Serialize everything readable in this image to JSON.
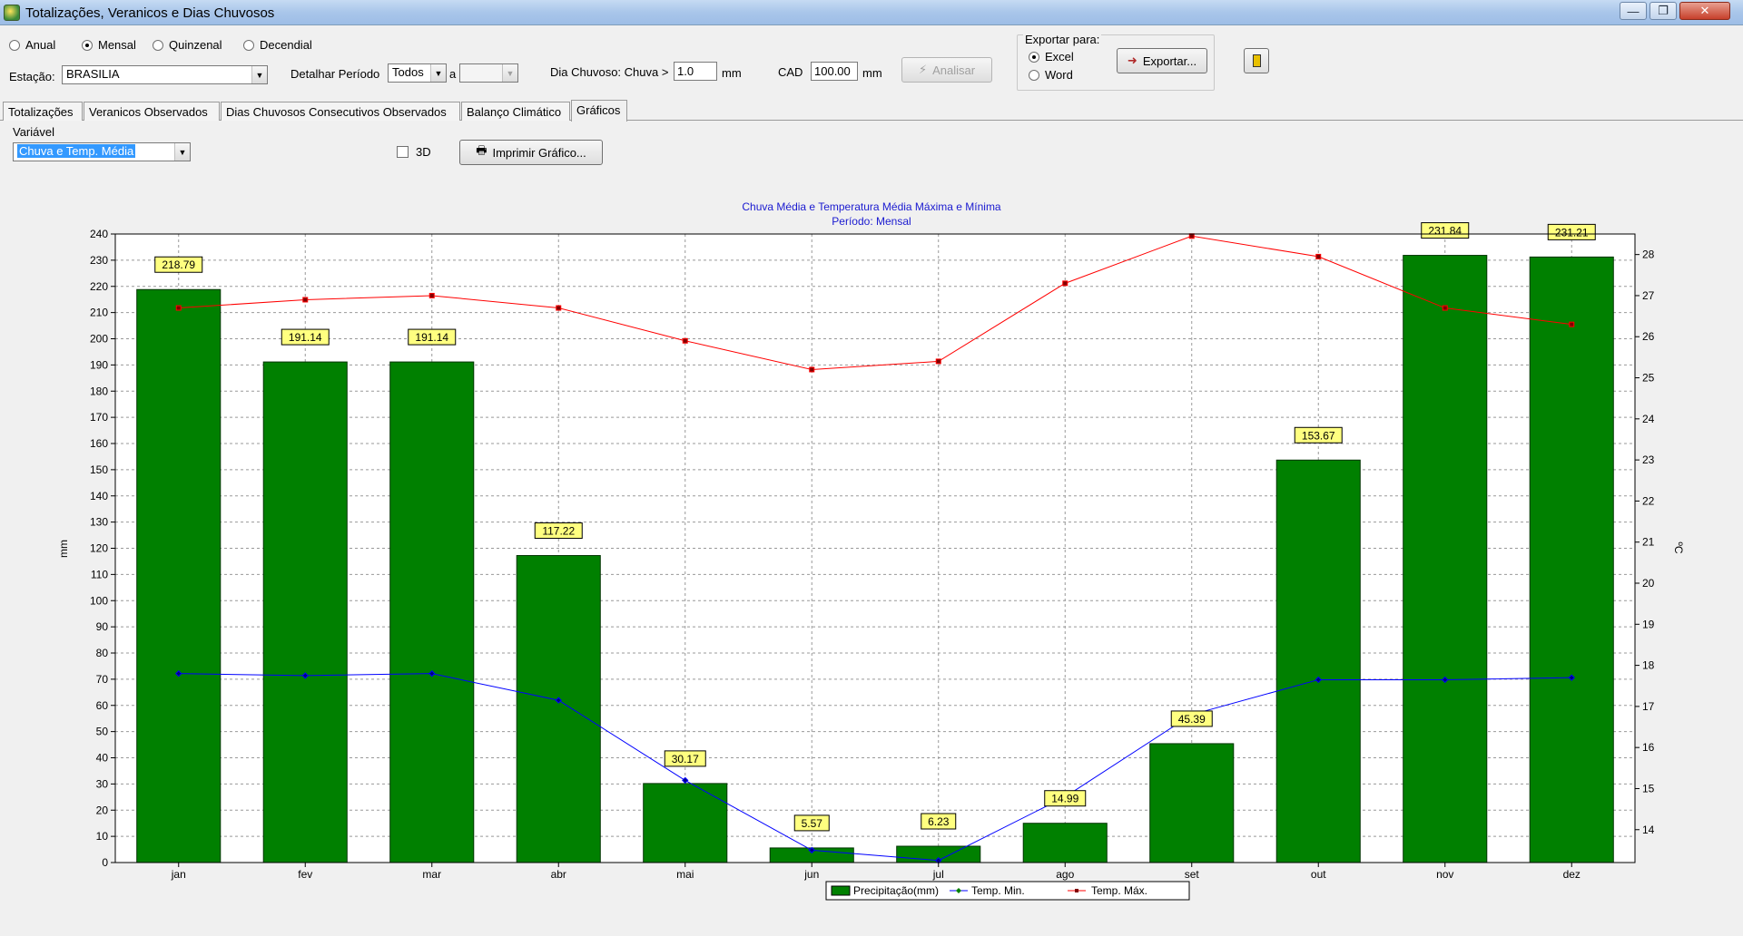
{
  "window": {
    "title": "Totalizações, Veranicos e Dias Chuvosos"
  },
  "period_options": [
    {
      "label": "Anual",
      "selected": false
    },
    {
      "label": "Mensal",
      "selected": true
    },
    {
      "label": "Quinzenal",
      "selected": false
    },
    {
      "label": "Decendial",
      "selected": false
    }
  ],
  "station": {
    "label": "Estação:",
    "value": "BRASILIA"
  },
  "detail": {
    "label": "Detalhar Período",
    "from": "Todos",
    "sep": "a",
    "to": ""
  },
  "rainy_day": {
    "label": "Dia Chuvoso: Chuva >",
    "value": "1.0",
    "unit": "mm"
  },
  "cad": {
    "label": "CAD",
    "value": "100.00",
    "unit": "mm"
  },
  "analyze_button": "Analisar",
  "export": {
    "group_title": "Exportar para:",
    "options": [
      {
        "label": "Excel",
        "selected": true
      },
      {
        "label": "Word",
        "selected": false
      }
    ],
    "button": "Exportar..."
  },
  "tabs": [
    {
      "label": "Totalizações",
      "active": false
    },
    {
      "label": "Veranicos Observados",
      "active": false
    },
    {
      "label": "Dias Chuvosos Consecutivos Observados",
      "active": false
    },
    {
      "label": "Balanço Climático",
      "active": false
    },
    {
      "label": "Gráficos",
      "active": true
    }
  ],
  "variable": {
    "label": "Variável",
    "value": "Chuva e Temp. Média"
  },
  "three_d": {
    "label": "3D",
    "checked": false
  },
  "print_button": "Imprimir Gráfico...",
  "chart_data": {
    "type": "bar",
    "title": "Chuva Média e Temperatura Média Máxima e Mínima",
    "subtitle": "Período: Mensal",
    "categories": [
      "jan",
      "fev",
      "mar",
      "abr",
      "mai",
      "jun",
      "jul",
      "ago",
      "set",
      "out",
      "nov",
      "dez"
    ],
    "ylabel": "mm",
    "y2label": "ºC",
    "ylim": [
      0,
      240
    ],
    "y_ticks": [
      "0",
      "10",
      "20",
      "30",
      "40",
      "50",
      "60",
      "70",
      "80",
      "90",
      "100",
      "110",
      "120",
      "130",
      "140",
      "150",
      "160",
      "170",
      "180",
      "190",
      "200",
      "210",
      "220",
      "230",
      "240"
    ],
    "y2lim": [
      13.2,
      28.5
    ],
    "y2_ticks": [
      "14",
      "15",
      "16",
      "17",
      "18",
      "19",
      "20",
      "21",
      "22",
      "23",
      "24",
      "25",
      "26",
      "27",
      "28"
    ],
    "grid": true,
    "legend_position": "bottom",
    "series": [
      {
        "name": "Precipitação(mm)",
        "kind": "bar",
        "axis": "left",
        "color": "#008000",
        "values": [
          218.79,
          191.14,
          191.14,
          117.22,
          30.17,
          5.57,
          6.23,
          14.99,
          45.39,
          153.67,
          231.84,
          231.21
        ],
        "labels": [
          "218.79",
          "191.14",
          "191.14",
          "117.22",
          "30.17",
          "5.57",
          "6.23",
          "14.99",
          "45.39",
          "153.67",
          "231.84",
          "231.21"
        ]
      },
      {
        "name": "Temp. Min.",
        "kind": "line",
        "axis": "right",
        "color": "#0000ff",
        "values": [
          17.8,
          17.75,
          17.8,
          17.15,
          15.2,
          13.5,
          13.25,
          14.8,
          16.8,
          17.65,
          17.65,
          17.7
        ]
      },
      {
        "name": "Temp. Máx.",
        "kind": "line",
        "axis": "right",
        "color": "#ff0000",
        "values": [
          26.7,
          26.9,
          27.0,
          26.7,
          25.9,
          25.2,
          25.4,
          27.3,
          28.45,
          27.95,
          26.7,
          26.3
        ]
      }
    ]
  }
}
